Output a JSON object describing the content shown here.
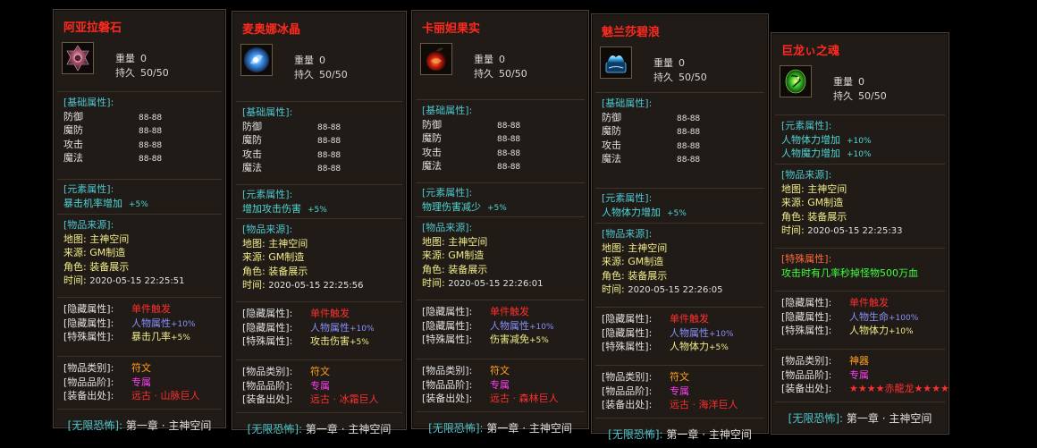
{
  "cards": [
    {
      "title": "阿亚拉磐石",
      "icon": "pink-stone-icon",
      "weight_label": "重量",
      "weight_value": "0",
      "dur_label": "持久",
      "dur_value": "50/50",
      "base_head": "[基础属性]:",
      "base": [
        {
          "k": "防御",
          "v": "88-88"
        },
        {
          "k": "魔防",
          "v": "88-88"
        },
        {
          "k": "攻击",
          "v": "88-88"
        },
        {
          "k": "魔法",
          "v": "88-88"
        }
      ],
      "elem_head": "[元素属性]:",
      "elem": [
        {
          "k": "暴击机率增加",
          "v": "+5%"
        }
      ],
      "src_head": "[物品来源]:",
      "src": [
        {
          "k": "地图:",
          "v": "主神空间"
        },
        {
          "k": "来源:",
          "v": "GM制造"
        },
        {
          "k": "角色:",
          "v": "装备展示"
        },
        {
          "k": "时间:",
          "v": "2020-05-15 22:25:51"
        }
      ],
      "special_head": "",
      "special_text": "",
      "hidden": [
        {
          "k": "[隐藏属性]:",
          "v": "单件触发",
          "suf": ""
        },
        {
          "k": "[隐藏属性]:",
          "v": "人物属性",
          "suf": "+10%"
        },
        {
          "k": "[特殊属性]:",
          "v": "暴击几率",
          "suf": "+5%"
        }
      ],
      "cat": [
        {
          "k": "[物品类别]:",
          "v": "符文"
        },
        {
          "k": "[物品品阶]:",
          "v": "专属"
        },
        {
          "k": "[装备出处]:",
          "v": "远古 · 山脉巨人"
        }
      ],
      "footer_label": "[无限恐怖]:",
      "footer_value": "第一章 · 主神空间"
    },
    {
      "title": "麦奥娜冰晶",
      "icon": "ice-crystal-icon",
      "weight_label": "重量",
      "weight_value": "0",
      "dur_label": "持久",
      "dur_value": "50/50",
      "base_head": "[基础属性]:",
      "base": [
        {
          "k": "防御",
          "v": "88-88"
        },
        {
          "k": "魔防",
          "v": "88-88"
        },
        {
          "k": "攻击",
          "v": "88-88"
        },
        {
          "k": "魔法",
          "v": "88-88"
        }
      ],
      "elem_head": "[元素属性]:",
      "elem": [
        {
          "k": "增加攻击伤害",
          "v": "+5%"
        }
      ],
      "src_head": "[物品来源]:",
      "src": [
        {
          "k": "地图:",
          "v": "主神空间"
        },
        {
          "k": "来源:",
          "v": "GM制造"
        },
        {
          "k": "角色:",
          "v": "装备展示"
        },
        {
          "k": "时间:",
          "v": "2020-05-15 22:25:56"
        }
      ],
      "special_head": "",
      "special_text": "",
      "hidden": [
        {
          "k": "[隐藏属性]:",
          "v": "单件触发",
          "suf": ""
        },
        {
          "k": "[隐藏属性]:",
          "v": "人物属性",
          "suf": "+10%"
        },
        {
          "k": "[特殊属性]:",
          "v": "攻击伤害",
          "suf": "+5%"
        }
      ],
      "cat": [
        {
          "k": "[物品类别]:",
          "v": "符文"
        },
        {
          "k": "[物品品阶]:",
          "v": "专属"
        },
        {
          "k": "[装备出处]:",
          "v": "远古 · 冰霜巨人"
        }
      ],
      "footer_label": "[无限恐怖]:",
      "footer_value": "第一章 · 主神空间"
    },
    {
      "title": "卡丽妲果实",
      "icon": "red-fruit-icon",
      "weight_label": "重量",
      "weight_value": "0",
      "dur_label": "持久",
      "dur_value": "50/50",
      "base_head": "[基础属性]:",
      "base": [
        {
          "k": "防御",
          "v": "88-88"
        },
        {
          "k": "魔防",
          "v": "88-88"
        },
        {
          "k": "攻击",
          "v": "88-88"
        },
        {
          "k": "魔法",
          "v": "88-88"
        }
      ],
      "elem_head": "[元素属性]:",
      "elem": [
        {
          "k": "物理伤害减少",
          "v": "+5%"
        }
      ],
      "src_head": "[物品来源]:",
      "src": [
        {
          "k": "地图:",
          "v": "主神空间"
        },
        {
          "k": "来源:",
          "v": "GM制造"
        },
        {
          "k": "角色:",
          "v": "装备展示"
        },
        {
          "k": "时间:",
          "v": "2020-05-15 22:26:01"
        }
      ],
      "special_head": "",
      "special_text": "",
      "hidden": [
        {
          "k": "[隐藏属性]:",
          "v": "单件触发",
          "suf": ""
        },
        {
          "k": "[隐藏属性]:",
          "v": "人物属性",
          "suf": "+10%"
        },
        {
          "k": "[特殊属性]:",
          "v": "伤害减免",
          "suf": "+5%"
        }
      ],
      "cat": [
        {
          "k": "[物品类别]:",
          "v": "符文"
        },
        {
          "k": "[物品品阶]:",
          "v": "专属"
        },
        {
          "k": "[装备出处]:",
          "v": "远古 · 森林巨人"
        }
      ],
      "footer_label": "[无限恐怖]:",
      "footer_value": "第一章 · 主神空间"
    },
    {
      "title": "魅兰莎碧浪",
      "icon": "blue-wave-icon",
      "weight_label": "重量",
      "weight_value": "0",
      "dur_label": "持久",
      "dur_value": "50/50",
      "base_head": "[基础属性]:",
      "base": [
        {
          "k": "防御",
          "v": "88-88"
        },
        {
          "k": "魔防",
          "v": "88-88"
        },
        {
          "k": "攻击",
          "v": "88-88"
        },
        {
          "k": "魔法",
          "v": "88-88"
        }
      ],
      "elem_head": "[元素属性]:",
      "elem": [
        {
          "k": "人物体力增加",
          "v": "+5%"
        }
      ],
      "src_head": "[物品来源]:",
      "src": [
        {
          "k": "地图:",
          "v": "主神空间"
        },
        {
          "k": "来源:",
          "v": "GM制造"
        },
        {
          "k": "角色:",
          "v": "装备展示"
        },
        {
          "k": "时间:",
          "v": "2020-05-15 22:26:05"
        }
      ],
      "special_head": "",
      "special_text": "",
      "hidden": [
        {
          "k": "[隐藏属性]:",
          "v": "单件触发",
          "suf": ""
        },
        {
          "k": "[隐藏属性]:",
          "v": "人物属性",
          "suf": "+10%"
        },
        {
          "k": "[特殊属性]:",
          "v": "人物体力",
          "suf": "+5%"
        }
      ],
      "cat": [
        {
          "k": "[物品类别]:",
          "v": "符文"
        },
        {
          "k": "[物品品阶]:",
          "v": "专属"
        },
        {
          "k": "[装备出处]:",
          "v": "远古 · 海洋巨人"
        }
      ],
      "footer_label": "[无限恐怖]:",
      "footer_value": "第一章 · 主神空间"
    },
    {
      "title": "巨龙ぃ之魂",
      "icon": "green-dragon-orb-icon",
      "weight_label": "重量",
      "weight_value": "0",
      "dur_label": "持久",
      "dur_value": "50/50",
      "base_head": "",
      "base": [],
      "elem_head": "[元素属性]:",
      "elem": [
        {
          "k": "人物体力增加",
          "v": "+10%"
        },
        {
          "k": "人物魔力增加",
          "v": "+10%"
        }
      ],
      "src_head": "[物品来源]:",
      "src": [
        {
          "k": "地图:",
          "v": "主神空间"
        },
        {
          "k": "来源:",
          "v": "GM制造"
        },
        {
          "k": "角色:",
          "v": "装备展示"
        },
        {
          "k": "时间:",
          "v": "2020-05-15 22:25:33"
        }
      ],
      "special_head": "[特殊属性]:",
      "special_text": "攻击时有几率秒掉怪物500万血",
      "hidden": [
        {
          "k": "[隐藏属性]:",
          "v": "单件触发",
          "suf": ""
        },
        {
          "k": "[隐藏属性]:",
          "v": "人物生命",
          "suf": "+100%"
        },
        {
          "k": "[特殊属性]:",
          "v": "人物体力",
          "suf": "+10%"
        }
      ],
      "cat": [
        {
          "k": "[物品类别]:",
          "v": "神器"
        },
        {
          "k": "[物品品阶]:",
          "v": "专属"
        },
        {
          "k": "[装备出处]:",
          "v": "★★★★赤龍龙★★★★"
        }
      ],
      "footer_label": "[无限恐怖]:",
      "footer_value": "第一章 · 主神空间"
    }
  ],
  "colors": {
    "title": "#ff2a1f",
    "header": "#4ec6cf",
    "source": "#f1ec8a",
    "trigger": "#ff2f2f",
    "attr": "#8890ff",
    "rank": "#ff3cf2",
    "category": "#ffa020",
    "special": "#40ff40"
  }
}
